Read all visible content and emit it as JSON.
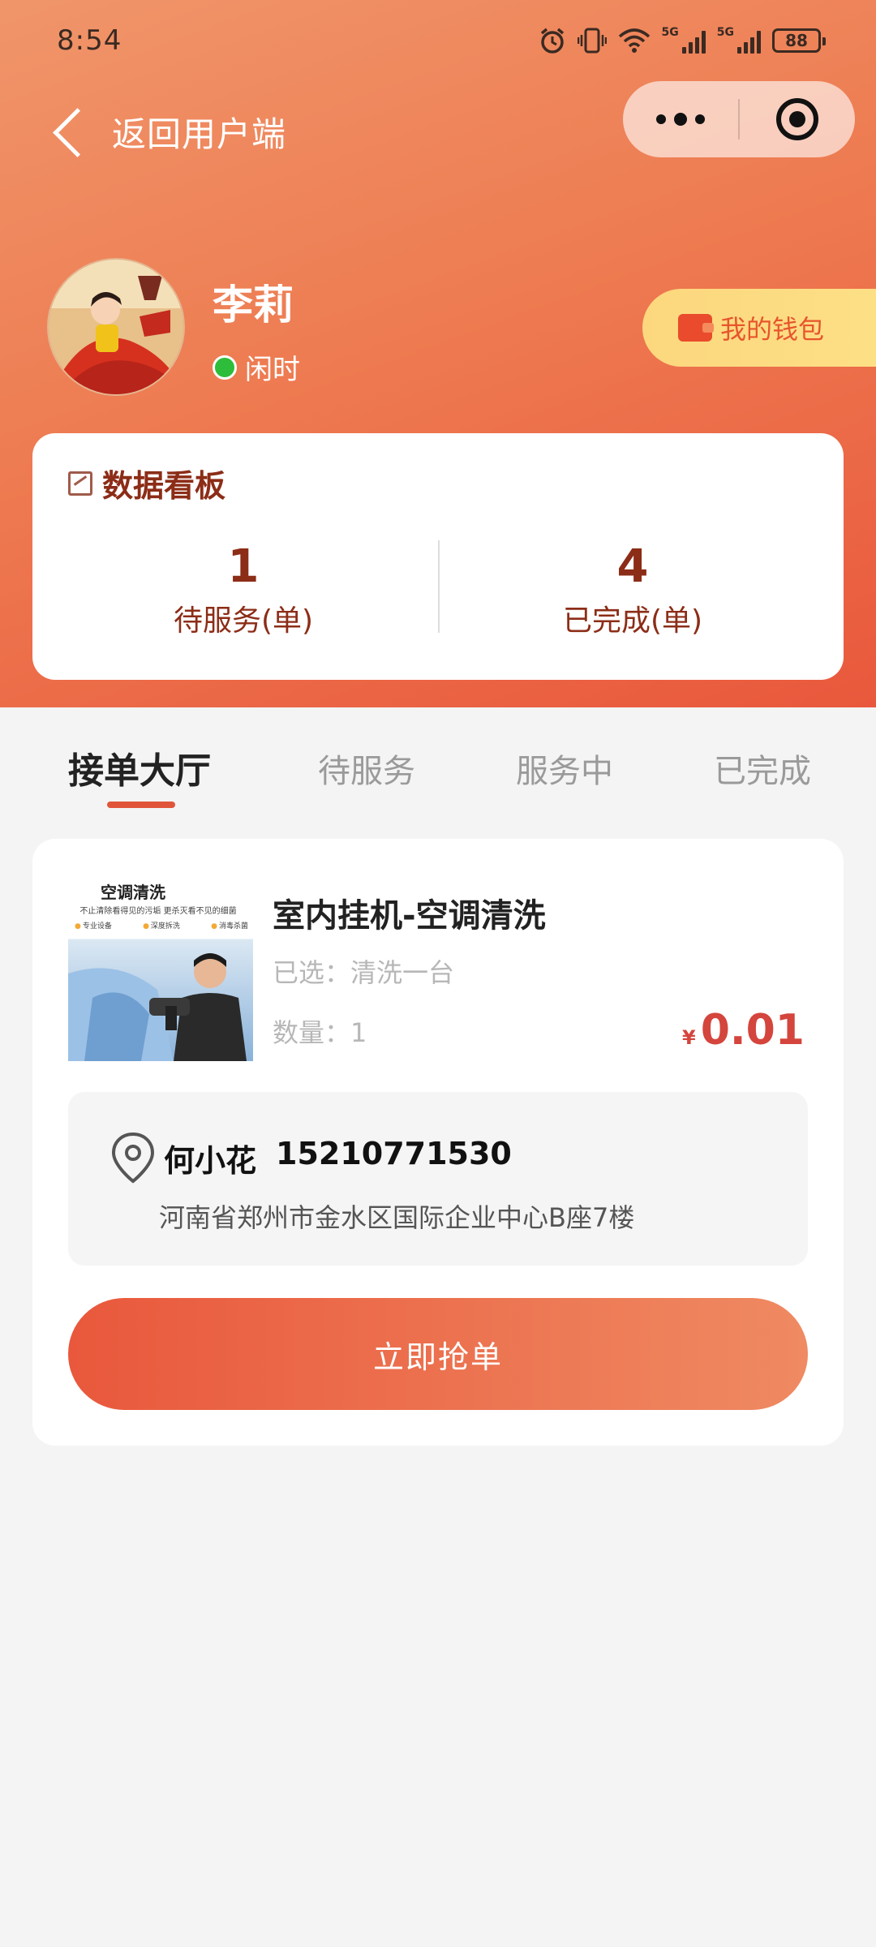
{
  "status_bar": {
    "time": "8:54",
    "network_1": "5G",
    "network_2": "5G",
    "battery": "88"
  },
  "nav": {
    "back_label": "返回用户端"
  },
  "profile": {
    "name": "李莉",
    "status": "闲时",
    "status_color": "#2dbd3a",
    "wallet_label": "我的钱包"
  },
  "dashboard": {
    "title": "数据看板",
    "pending_count": "1",
    "pending_label": "待服务(单)",
    "completed_count": "4",
    "completed_label": "已完成(单)"
  },
  "tabs": [
    {
      "label": "接单大厅",
      "active": true
    },
    {
      "label": "待服务",
      "active": false
    },
    {
      "label": "服务中",
      "active": false
    },
    {
      "label": "已完成",
      "active": false
    }
  ],
  "order": {
    "image": {
      "title": "空调清洗",
      "subtitle": "不止清除看得见的污垢 更杀灭看不见的细菌",
      "chips": [
        "专业设备",
        "深度拆洗",
        "消毒杀菌"
      ]
    },
    "title": "室内挂机-空调清洗",
    "spec": "已选：清洗一台",
    "quantity": "数量：1",
    "price_symbol": "¥",
    "price": "0.01",
    "contact_name": "何小花",
    "contact_phone": "15210771530",
    "address": "河南省郑州市金水区国际企业中心B座7楼",
    "action_label": "立即抢单"
  },
  "colors": {
    "header_gradient_start": "#f0956a",
    "header_gradient_end": "#e9583c",
    "accent": "#e0553a",
    "price": "#d4453d",
    "dashboard_text": "#8c2d17",
    "wallet_bg": "#fcd77e"
  },
  "icons": {
    "back": "chevron-left-icon",
    "more": "more-dots-icon",
    "close": "target-close-icon",
    "wallet": "wallet-icon",
    "dashboard": "chart-icon",
    "location": "location-pin-icon"
  }
}
